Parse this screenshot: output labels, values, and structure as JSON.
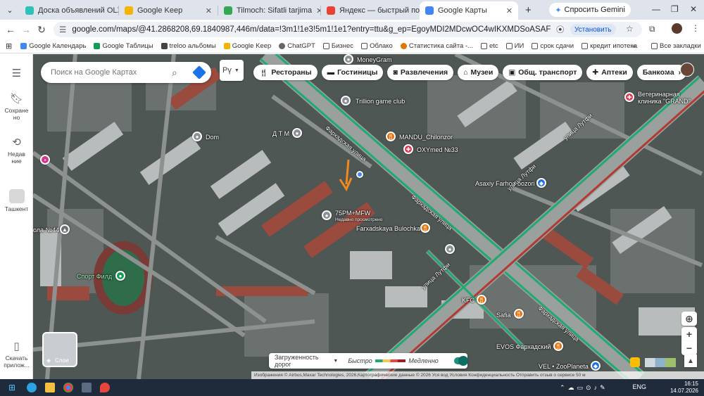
{
  "tabs": [
    {
      "title": "Доска объявлений OLX.uz",
      "color": "#2fc0b8"
    },
    {
      "title": "Google Keep",
      "color": "#f4b400"
    },
    {
      "title": "Tilmoch: Sifatli tarjima",
      "color": "#34a853"
    },
    {
      "title": "Яндекс — быстрый поиск",
      "color": "#ea4335"
    },
    {
      "title": "Google Карты",
      "color": "#4285f4",
      "active": true
    }
  ],
  "gemini": "Спросить Gemini",
  "url": "google.com/maps/@41.2868208,69.1840987,446m/data=!3m1!1e3!5m1!1e1?entry=ttu&g_ep=EgoyMDI2MDcwOC4wIKXMDSoASAFQAw%3D%3D",
  "install": "Установить",
  "bookmarks": [
    "Google Календарь",
    "Google Таблицы",
    "treloo альбомы",
    "Google Keep",
    "ChatGPT",
    "Бизнес",
    "Облако",
    "Статистика сайта -...",
    "etc",
    "ИИ",
    "срок сдачи",
    "кредит ипотека"
  ],
  "bookmarks_all": "Все закладки",
  "rail": {
    "saved": "Сохране\nно",
    "recent": "Недавние",
    "city": "Ташкент",
    "download": "Скачать\nприлож..."
  },
  "search_placeholder": "Поиск на Google Картах",
  "lang_btn": "Рү",
  "chips": [
    "Рестораны",
    "Гостиницы",
    "Развлечения",
    "Музеи",
    "Общ. транспорт",
    "Аптеки",
    "Банкомa"
  ],
  "places": {
    "moneygram": "MoneyGram",
    "trillion": "Trillion game club",
    "mandu": "MANDU_Chilonzor",
    "oxymed": "OXYmed №33",
    "vet": "Ветеринарная\nклиника \"GRAND\"",
    "dom": "Dom",
    "dtm": "Д Т М",
    "asaxiy": "Asaxiy Farhod bozori",
    "plus": "75PM+MFW",
    "plus_sub": "Недавно просмотрено",
    "bulochka": "Farxadskaya Bulochka",
    "sport": "Спорт Филд",
    "school": "ола №44",
    "kfc": "KFC",
    "safia": "Safia",
    "evos": "EVOS Фархадский",
    "vel": "VEL • ZooPlaneta",
    "street1": "Фархадская улица",
    "street2": "Фархадская улица",
    "street3": "Фархадская улица",
    "lutfi1": "улица Лутфи",
    "lutfi2": "улица Лутфи",
    "lutfi3": "улица Лутфи"
  },
  "traffic": {
    "label": "Загруженность дорог",
    "fast": "Быстро",
    "slow": "Медленно"
  },
  "layers": "Слои",
  "attrib": "Изображения © Airbus,Maxar Technologies, 2026,Картографические данные © 2026   Уся вод   Условия   Конфиденциальность   Отправить отзыв о сервисе   50 м",
  "tray": {
    "lang": "ENG",
    "time": "16:15",
    "date": "14.07.2026"
  }
}
